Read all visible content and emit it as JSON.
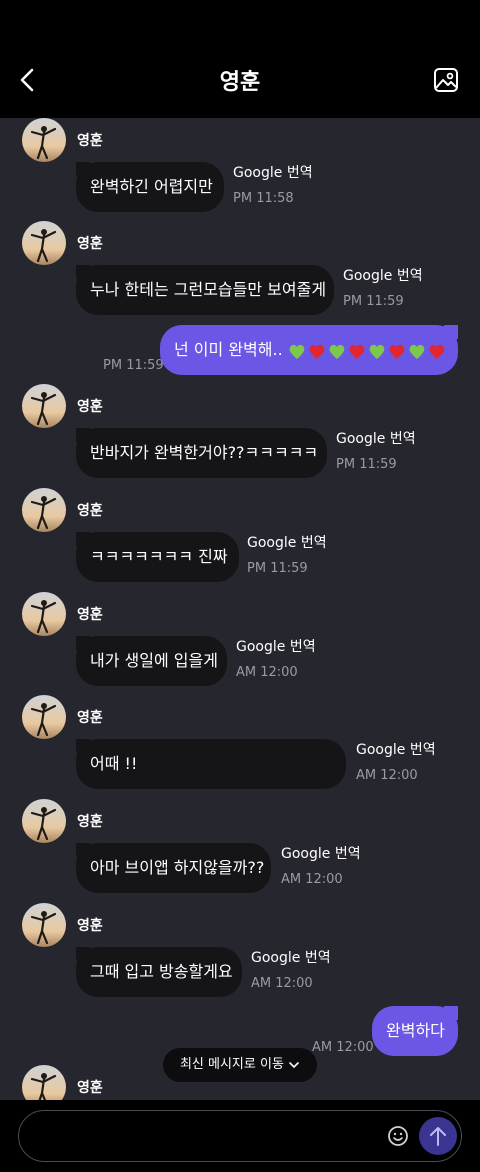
{
  "header": {
    "title": "영훈",
    "back_icon": "chevron-left-icon",
    "gallery_icon": "image-icon"
  },
  "messages": [
    {
      "sender": "영훈",
      "text": "완벽하긴 어렵지만",
      "translate": "Google 번역",
      "time": "PM 11:58"
    },
    {
      "sender": "영훈",
      "text": "누나 한테는 그런모습들만 보여줄게",
      "translate": "Google 번역",
      "time": "PM 11:59"
    },
    {
      "sender": "영훈",
      "text": "반바지가 완벽한거야??ㅋㅋㅋㅋㅋ",
      "translate": "Google 번역",
      "time": "PM 11:59"
    },
    {
      "sender": "영훈",
      "text": "ㅋㅋㅋㅋㅋㅋㅋ 진짜",
      "translate": "Google 번역",
      "time": "PM 11:59"
    },
    {
      "sender": "영훈",
      "text": "내가 생일에 입을게",
      "translate": "Google 번역",
      "time": "AM 12:00"
    },
    {
      "sender": "영훈",
      "text": "어때 !!",
      "translate": "Google 번역",
      "time": "AM 12:00"
    },
    {
      "sender": "영훈",
      "text": "아마 브이앱 하지않을까??",
      "translate": "Google 번역",
      "time": "AM 12:00"
    },
    {
      "sender": "영훈",
      "text": "그때 입고 방송할게요",
      "translate": "Google 번역",
      "time": "AM 12:00"
    },
    {
      "sender": "영훈"
    }
  ],
  "my_messages": [
    {
      "text": "넌 이미 완벽해..",
      "emoji": [
        "green-heart",
        "red-heart",
        "green-heart",
        "red-heart",
        "green-heart",
        "red-heart",
        "green-heart",
        "red-heart"
      ],
      "time": "PM 11:59"
    },
    {
      "text": "완벽하다",
      "time": "AM 12:00"
    }
  ],
  "new_message_pill": {
    "label": "최신 메시지로 이동",
    "icon": "chevron-down-icon"
  },
  "composer": {
    "value": "",
    "placeholder": "",
    "emoji_icon": "smiley-icon",
    "send_icon": "arrow-up-icon"
  },
  "colors": {
    "my_bubble": "#6b57e6",
    "their_bubble": "#151518",
    "background": "#26262e",
    "green_heart": "#7cc84a",
    "red_heart": "#e0262e"
  }
}
